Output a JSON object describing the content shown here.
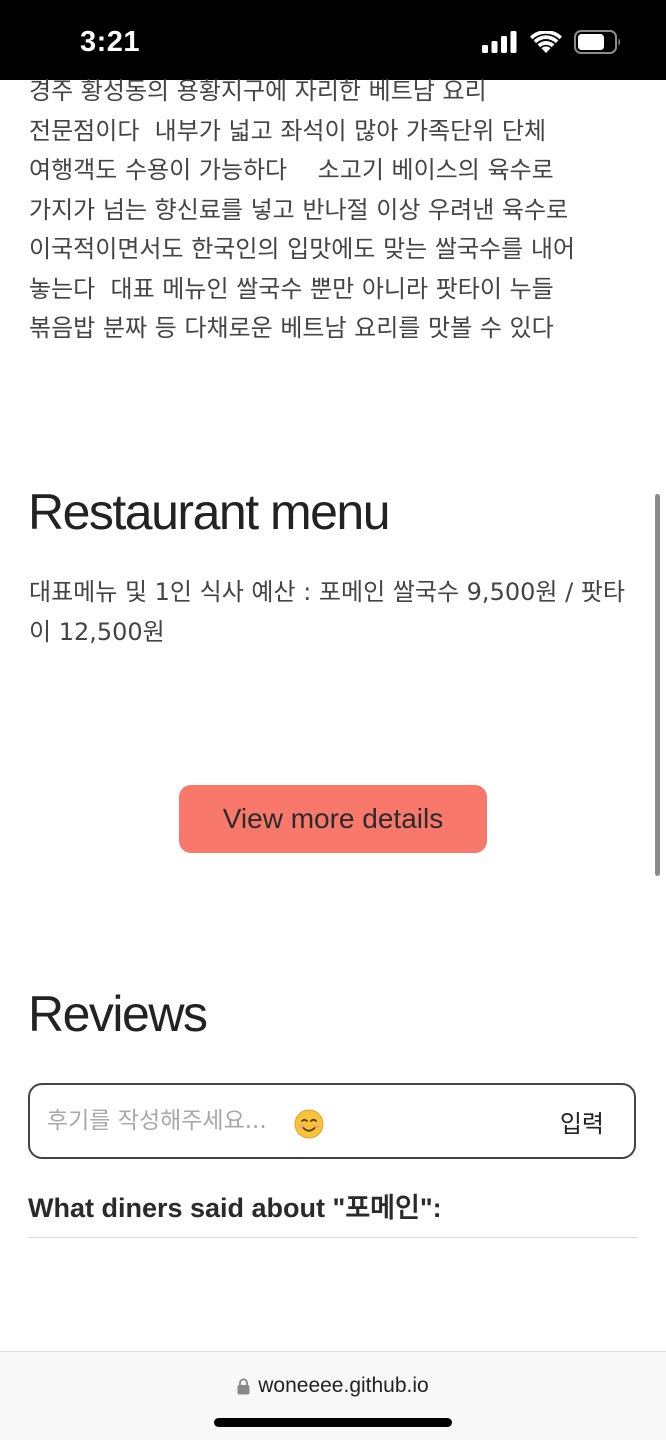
{
  "status_bar": {
    "time": "3:21",
    "signal_icon": "cellular-signal-icon",
    "wifi_icon": "wifi-icon",
    "battery_icon": "battery-icon"
  },
  "description": "경주 황성동의 용황지구에 자리한 베트남 요리\n전문점이다  내부가 넓고 좌석이 많아 가족단위 단체\n여행객도 수용이 가능하다    소고기 베이스의 육수로\n가지가 넘는 향신료를 넣고 반나절 이상 우려낸 육수로\n이국적이면서도 한국인의 입맛에도 맞는 쌀국수를 내어\n놓는다  대표 메뉴인 쌀국수 뿐만 아니라 팟타이 누들\n볶음밥 분짜 등 다채로운 베트남 요리를 맛볼 수 있다",
  "menu_section": {
    "title": "Restaurant menu",
    "info": "대표메뉴 및 1인 식사 예산 : 포메인 쌀국수 9,500원 / 팟타이 12,500원"
  },
  "details_button": {
    "label": "View more details",
    "color": "#f8796c"
  },
  "reviews_section": {
    "title": "Reviews",
    "input_placeholder": "후기를 작성해주세요...",
    "emoji_icon": "smiling-face-icon",
    "submit_label": "입력",
    "diners_heading": "What diners said about \"포메인\":"
  },
  "browser": {
    "lock_icon": "lock-icon",
    "url": "woneeee.github.io"
  }
}
